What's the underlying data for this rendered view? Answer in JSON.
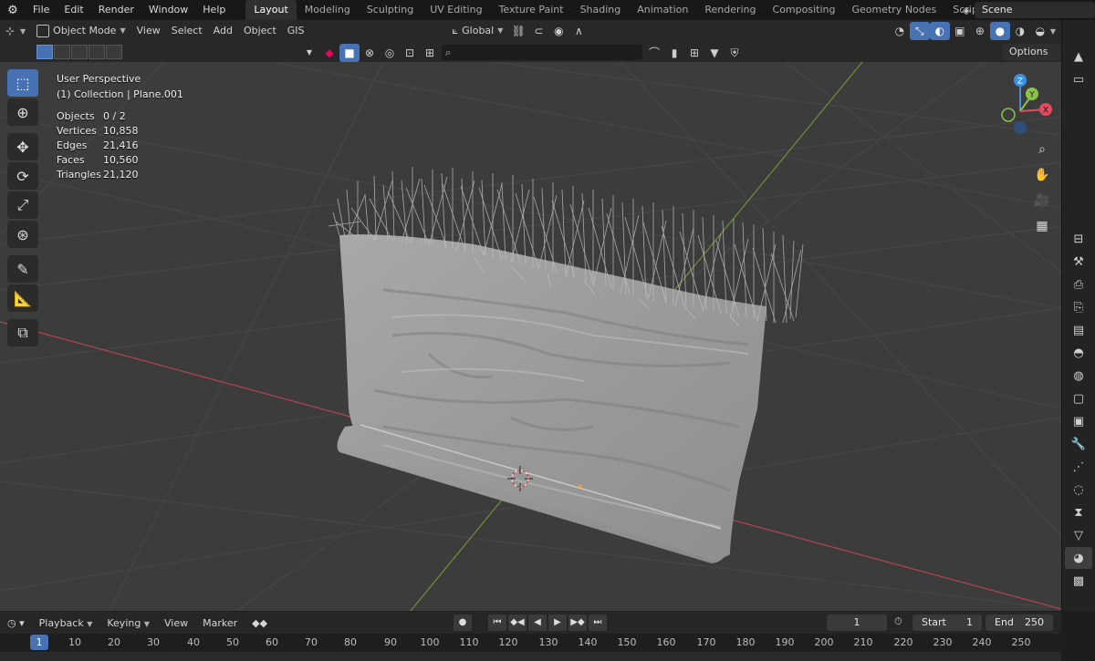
{
  "menu": {
    "items": [
      "File",
      "Edit",
      "Render",
      "Window",
      "Help"
    ],
    "workspaces": [
      "Layout",
      "Modeling",
      "Sculpting",
      "UV Editing",
      "Texture Paint",
      "Shading",
      "Animation",
      "Rendering",
      "Compositing",
      "Geometry Nodes",
      "Scripting"
    ],
    "active_workspace": "Layout",
    "plus": "+",
    "scene": "Scene"
  },
  "header": {
    "mode": "Object Mode",
    "menus": [
      "View",
      "Select",
      "Add",
      "Object",
      "GIS"
    ],
    "transform_orientation": "Global",
    "options": "Options"
  },
  "overlay": {
    "perspective": "User Perspective",
    "collection": "(1) Collection | Plane.001",
    "stats": [
      {
        "label": "Objects",
        "value": "0 / 2"
      },
      {
        "label": "Vertices",
        "value": "10,858"
      },
      {
        "label": "Edges",
        "value": "21,416"
      },
      {
        "label": "Faces",
        "value": "10,560"
      },
      {
        "label": "Triangles",
        "value": "21,120"
      }
    ]
  },
  "gizmo": {
    "z": "Z",
    "y": "Y",
    "x": "X"
  },
  "timeline": {
    "menus": [
      "Playback",
      "Keying",
      "View",
      "Marker"
    ],
    "current_frame": "1",
    "start_label": "Start",
    "start": "1",
    "end_label": "End",
    "end": "250",
    "ticks": [
      "1",
      "10",
      "20",
      "30",
      "40",
      "50",
      "60",
      "70",
      "80",
      "90",
      "100",
      "110",
      "120",
      "130",
      "140",
      "150",
      "160",
      "170",
      "180",
      "190",
      "200",
      "210",
      "220",
      "230",
      "240",
      "250"
    ]
  },
  "colors": {
    "accent": "#4772b3",
    "x_axis": "#e24c5e",
    "y_axis": "#8bc34a",
    "z_axis": "#3d8fe0",
    "grid": "#4a4a4a"
  }
}
